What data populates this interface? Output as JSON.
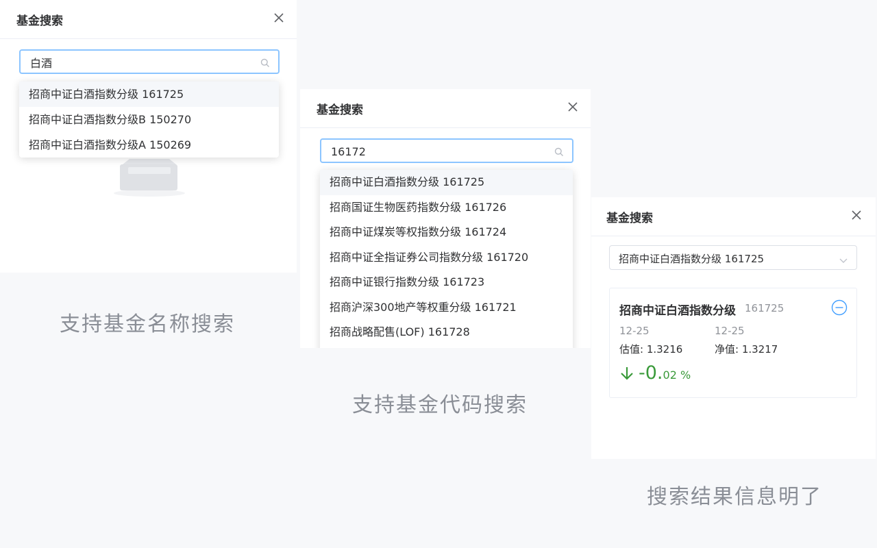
{
  "panel_name_search": {
    "title": "基金搜索",
    "search_value": "白酒",
    "options": [
      "招商中证白酒指数分级 161725",
      "招商中证白酒指数分级B 150270",
      "招商中证白酒指数分级A 150269"
    ],
    "highlighted_index": 0,
    "caption": "支持基金名称搜索"
  },
  "panel_code_search": {
    "title": "基金搜索",
    "search_value": "16172",
    "options": [
      "招商中证白酒指数分级 161725",
      "招商国证生物医药指数分级 161726",
      "招商中证煤炭等权指数分级 161724",
      "招商中证全指证券公司指数分级 161720",
      "招商中证银行指数分级 161723",
      "招商沪深300地产等权重分级 161721",
      "招商战略配售(LOF) 161728"
    ],
    "highlighted_index": 0,
    "caption": "支持基金代码搜索"
  },
  "panel_result": {
    "title": "基金搜索",
    "selected_value": "招商中证白酒指数分级 161725",
    "card": {
      "fund_name": "招商中证白酒指数分级",
      "fund_code": "161725",
      "estimate_date": "12-25",
      "nav_date": "12-25",
      "estimate_label": "估值: 1.3216",
      "nav_label": "净值: 1.3217",
      "change_int": "-0.",
      "change_frac": "02",
      "change_unit": "%",
      "change_color": "#3a9a3a"
    },
    "caption": "搜索结果信息明了"
  },
  "icons": {
    "close": "close-icon",
    "search": "search-icon",
    "chevron": "chevron-down-icon",
    "remove": "minus-circle-icon",
    "arrow": "arrow-down-icon",
    "empty": "empty-box-icon"
  },
  "colors": {
    "input_focus_border": "#8cc5ff",
    "remove_icon": "#409eff",
    "down_change": "#3a9a3a"
  }
}
